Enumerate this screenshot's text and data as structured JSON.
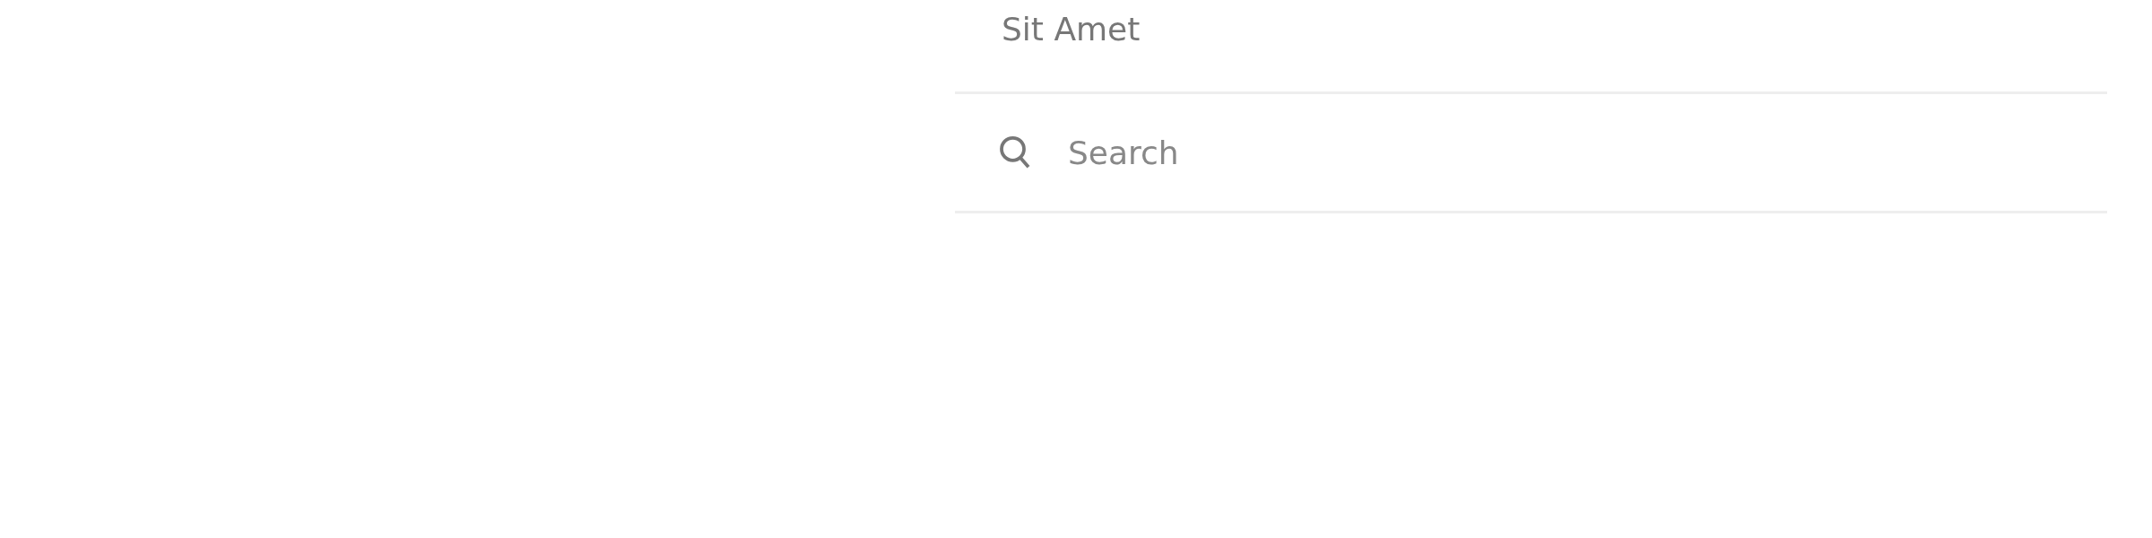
{
  "list": {
    "items": [
      {
        "label": "Sit Amet"
      }
    ]
  },
  "search": {
    "placeholder": "Search"
  }
}
